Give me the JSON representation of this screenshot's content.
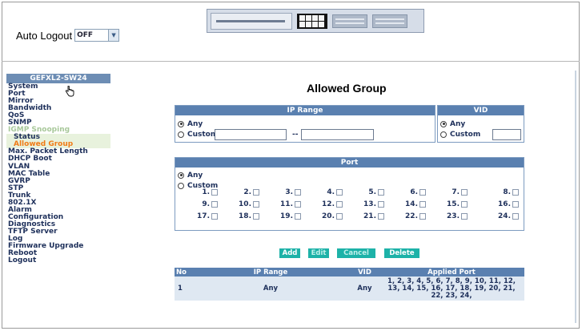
{
  "header": {
    "auto_logout_label": "Auto Logout",
    "auto_logout_value": "OFF"
  },
  "sidebar": {
    "title": "GEFXL2-SW24",
    "items": [
      {
        "label": "System",
        "kind": "top"
      },
      {
        "label": "Port",
        "kind": "top"
      },
      {
        "label": "Mirror",
        "kind": "top"
      },
      {
        "label": "Bandwidth",
        "kind": "top"
      },
      {
        "label": "QoS",
        "kind": "top"
      },
      {
        "label": "SNMP",
        "kind": "top"
      },
      {
        "label": "IGMP Snooping",
        "kind": "igmp"
      },
      {
        "label": "Status",
        "kind": "sub"
      },
      {
        "label": "Allowed Group",
        "kind": "active"
      },
      {
        "label": "Max. Packet Length",
        "kind": "top"
      },
      {
        "label": "DHCP Boot",
        "kind": "top"
      },
      {
        "label": "VLAN",
        "kind": "top"
      },
      {
        "label": "MAC Table",
        "kind": "top"
      },
      {
        "label": "GVRP",
        "kind": "top"
      },
      {
        "label": "STP",
        "kind": "top"
      },
      {
        "label": "Trunk",
        "kind": "top"
      },
      {
        "label": "802.1X",
        "kind": "top"
      },
      {
        "label": "Alarm",
        "kind": "top"
      },
      {
        "label": "Configuration",
        "kind": "top"
      },
      {
        "label": "Diagnostics",
        "kind": "top"
      },
      {
        "label": "TFTP Server",
        "kind": "top"
      },
      {
        "label": "Log",
        "kind": "top"
      },
      {
        "label": "Firmware Upgrade",
        "kind": "top"
      },
      {
        "label": "Reboot",
        "kind": "top"
      },
      {
        "label": "Logout",
        "kind": "top"
      }
    ]
  },
  "main": {
    "title": "Allowed Group",
    "ip_panel": {
      "header": "IP Range",
      "any_label": "Any",
      "custom_label": "Custom",
      "separator": "--",
      "ip_from_value": "",
      "ip_to_value": ""
    },
    "vid_panel": {
      "header": "VID",
      "any_label": "Any",
      "custom_label": "Custom",
      "vid_value": ""
    },
    "port_panel": {
      "header": "Port",
      "any_label": "Any",
      "custom_label": "Custom",
      "ports": [
        "1.",
        "2.",
        "3.",
        "4.",
        "5.",
        "6.",
        "7.",
        "8.",
        "9.",
        "10.",
        "11.",
        "12.",
        "13.",
        "14.",
        "15.",
        "16.",
        "17.",
        "18.",
        "19.",
        "20.",
        "21.",
        "22.",
        "23.",
        "24."
      ]
    },
    "buttons": {
      "add": "Add",
      "edit": "Edit",
      "cancel": "Cancel",
      "delete": "Delete"
    },
    "table": {
      "headers": [
        "No",
        "IP Range",
        "VID",
        "Applied Port"
      ],
      "rows": [
        {
          "no": "1",
          "ip_range": "Any",
          "vid": "Any",
          "applied_port": "1, 2, 3, 4, 5, 6, 7, 8, 9, 10, 11, 12, 13, 14, 15, 16, 17, 18, 19, 20, 21, 22, 23, 24,"
        }
      ]
    }
  },
  "colors": {
    "header_blue": "#5a80b0",
    "row_blue": "#dfe8f2",
    "button_teal": "#1db2a8",
    "active_orange": "#f07b16",
    "igmp_green": "#a8c89a"
  },
  "icons": {
    "cursor": "hand-pointer-icon",
    "dropdown": "chevron-down-icon",
    "device": "switch-front-panel-image"
  }
}
